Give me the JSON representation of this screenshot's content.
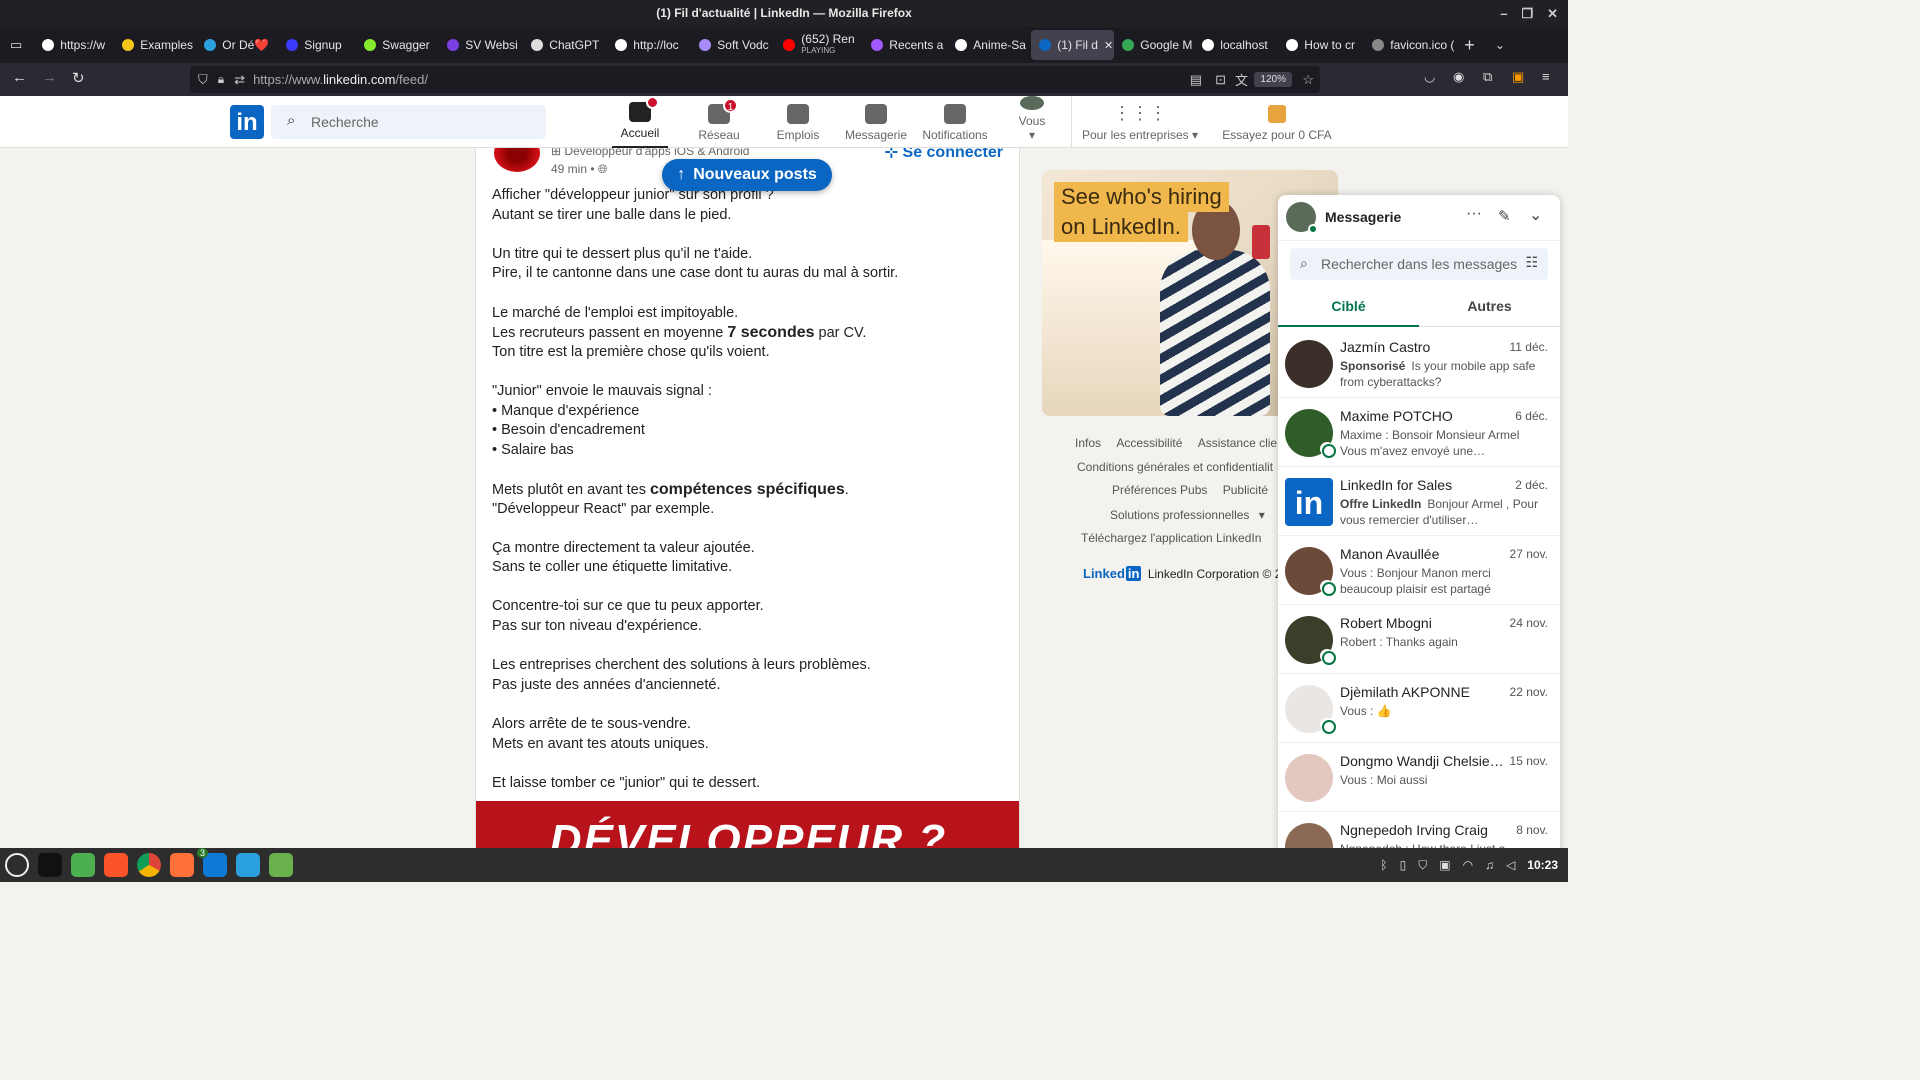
{
  "window": {
    "title": "(1) Fil d'actualité | LinkedIn — Mozilla Firefox"
  },
  "tabs": [
    {
      "label": "https://w",
      "color": "#ffffff"
    },
    {
      "label": "Examples",
      "color": "#f5c518"
    },
    {
      "label": "Or Dé❤️",
      "color": "#2aa1de"
    },
    {
      "label": "Signup",
      "color": "#3b3bff"
    },
    {
      "label": "Swagger",
      "color": "#85ea2d"
    },
    {
      "label": "SV Websi",
      "color": "#7b3fe4"
    },
    {
      "label": "ChatGPT",
      "color": "#dddddd"
    },
    {
      "label": "http://loc",
      "color": "#ffffff"
    },
    {
      "label": "Soft Vodc",
      "color": "#a78bfa"
    },
    {
      "label": "(652) Ren",
      "sub": "PLAYING",
      "color": "#ff0000"
    },
    {
      "label": "Recents a",
      "color": "#a259ff"
    },
    {
      "label": "Anime-Sa",
      "color": "#ffffff"
    },
    {
      "label": "(1) Fil d",
      "color": "#0a66c2",
      "active": true
    },
    {
      "label": "Google M",
      "color": "#34a853"
    },
    {
      "label": "localhost",
      "color": "#ffffff"
    },
    {
      "label": "How to cr",
      "color": "#ffffff"
    },
    {
      "label": "favicon.ico (",
      "color": "#888888"
    }
  ],
  "browser": {
    "url_prefix": "https://www.",
    "url_host": "linkedin.com",
    "url_path": "/feed/",
    "zoom": "120%"
  },
  "linkedin": {
    "search_placeholder": "Recherche",
    "nav": [
      {
        "label": "Accueil",
        "badge": "",
        "active": true
      },
      {
        "label": "Réseau",
        "badge": "1"
      },
      {
        "label": "Emplois",
        "badge": ""
      },
      {
        "label": "Messagerie",
        "badge": ""
      },
      {
        "label": "Notifications",
        "badge": ""
      },
      {
        "label": "Vous",
        "badge": ""
      }
    ],
    "business": "Pour les entreprises",
    "premium": "Essayez pour 0 CFA"
  },
  "post": {
    "author_title": "Développeur d'apps iOS & Android",
    "time": "49 min •",
    "connect": "Se connecter",
    "new_posts": "Nouveaux posts",
    "lines": [
      "Afficher \"développeur junior\" sur son profil ?",
      "Autant se tirer une balle dans le pied.",
      "",
      "Un titre qui te dessert plus qu'il ne t'aide.",
      "Pire, il te cantonne dans une case dont tu auras du mal à sortir.",
      "",
      "Le marché de l'emploi est impitoyable.",
      "Les recruteurs passent en moyenne 7 secondes par CV.",
      "Ton titre est la première chose qu'ils voient.",
      "",
      "\"Junior\" envoie le mauvais signal :",
      "• Manque d'expérience",
      "• Besoin d'encadrement",
      "• Salaire bas",
      "",
      "Mets plutôt en avant tes compétences spécifiques.",
      "\"Développeur React\" par exemple.",
      "",
      "Ça montre directement ta valeur ajoutée.",
      "Sans te coller une étiquette limitative.",
      "",
      "Concentre-toi sur ce que tu peux apporter.",
      "Pas sur ton niveau d'expérience.",
      "",
      "Les entreprises cherchent des solutions à leurs problèmes.",
      "Pas juste des années d'ancienneté.",
      "",
      "Alors arrête de te sous-vendre.",
      "Mets en avant tes atouts uniques.",
      "",
      "Et laisse tomber ce \"junior\" qui te dessert."
    ],
    "banner": "DÉVELOPPEUR ?"
  },
  "ad": {
    "line1": "See who's hiring",
    "line2": "on LinkedIn."
  },
  "footer": {
    "links": [
      "Infos",
      "Accessibilité",
      "Assistance clie",
      "Conditions générales et confidentialit",
      "Préférences Pubs",
      "Publicité",
      "Solutions professionnelles",
      "Téléchargez l'application LinkedIn"
    ],
    "brand": "Linked",
    "corp": "LinkedIn Corporation © 2("
  },
  "messaging": {
    "title": "Messagerie",
    "search_placeholder": "Rechercher dans les messages",
    "tab_focused": "Ciblé",
    "tab_other": "Autres",
    "conversations": [
      {
        "name": "Jazmín Castro",
        "date": "11 déc.",
        "label": "Sponsorisé",
        "preview": "Is your mobile app safe from cyberattacks?",
        "online": false,
        "avatar": "#3b2f2a"
      },
      {
        "name": "Maxime POTCHO",
        "date": "6 déc.",
        "label": "",
        "preview": "Maxime : Bonsoir Monsieur Armel Vous m'avez envoyé une…",
        "online": true,
        "avatar": "#2f5d2a"
      },
      {
        "name": "LinkedIn for Sales",
        "date": "2 déc.",
        "label": "Offre LinkedIn",
        "preview": "Bonjour Armel , Pour vous remercier d'utiliser…",
        "online": false,
        "avatar": "#0a66c2"
      },
      {
        "name": "Manon Avaullée",
        "date": "27 nov.",
        "label": "",
        "preview": "Vous : Bonjour Manon merci beaucoup plaisir est partagé",
        "online": true,
        "avatar": "#6b4a3a"
      },
      {
        "name": "Robert Mbogni",
        "date": "24 nov.",
        "label": "",
        "preview": "Robert : Thanks again",
        "online": true,
        "avatar": "#3a3f2a"
      },
      {
        "name": "Djèmilath AKPONNE",
        "date": "22 nov.",
        "label": "",
        "preview": "Vous : 👍",
        "online": true,
        "avatar": "#e9e6e3"
      },
      {
        "name": "Dongmo Wandji Chelsie…",
        "date": "15 nov.",
        "label": "",
        "preview": "Vous : Moi aussi",
        "online": false,
        "avatar": "#e3c8c0"
      },
      {
        "name": "Ngnepedoh Irving Craig",
        "date": "8 nov.",
        "label": "",
        "preview": "Ngnepedoh : How there I just a…",
        "online": false,
        "avatar": "#8a6a55"
      }
    ]
  },
  "taskbar": {
    "icons": [
      "menu-icon",
      "terminal-icon",
      "files-icon",
      "brave-icon",
      "chrome-icon",
      "firefox-icon",
      "vscode-icon",
      "telegram-icon",
      "mint-update-icon"
    ],
    "vscode_badge": "3",
    "time": "10:23"
  }
}
